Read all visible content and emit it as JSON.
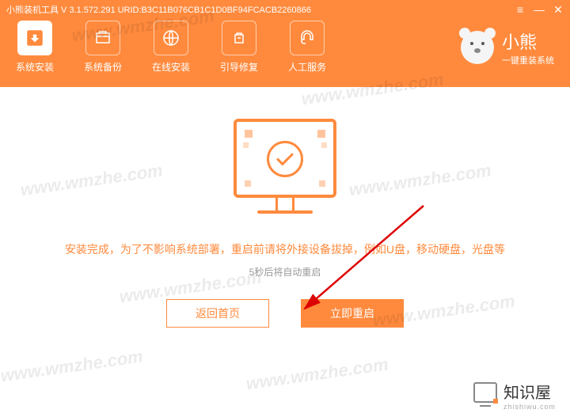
{
  "titlebar": {
    "text": "小熊装机工具 V 3.1.572.291 URID:B3C11B076CB1C1D0BF94FCACB2260866"
  },
  "nav": {
    "items": [
      {
        "label": "系统安装"
      },
      {
        "label": "系统备份"
      },
      {
        "label": "在线安装"
      },
      {
        "label": "引导修复"
      },
      {
        "label": "人工服务"
      }
    ]
  },
  "brand": {
    "title": "小熊",
    "subtitle": "一键重装系统"
  },
  "content": {
    "main_message": "安装完成，为了不影响系统部署，重启前请将外接设备拔掉，例如U盘，移动硬盘，光盘等",
    "sub_message": "5秒后将自动重启",
    "back_button": "返回首页",
    "restart_button": "立即重启"
  },
  "footer": {
    "brand": "知识屋",
    "url": "zhishiwu.com"
  },
  "watermark": "www.wmzhe.com"
}
